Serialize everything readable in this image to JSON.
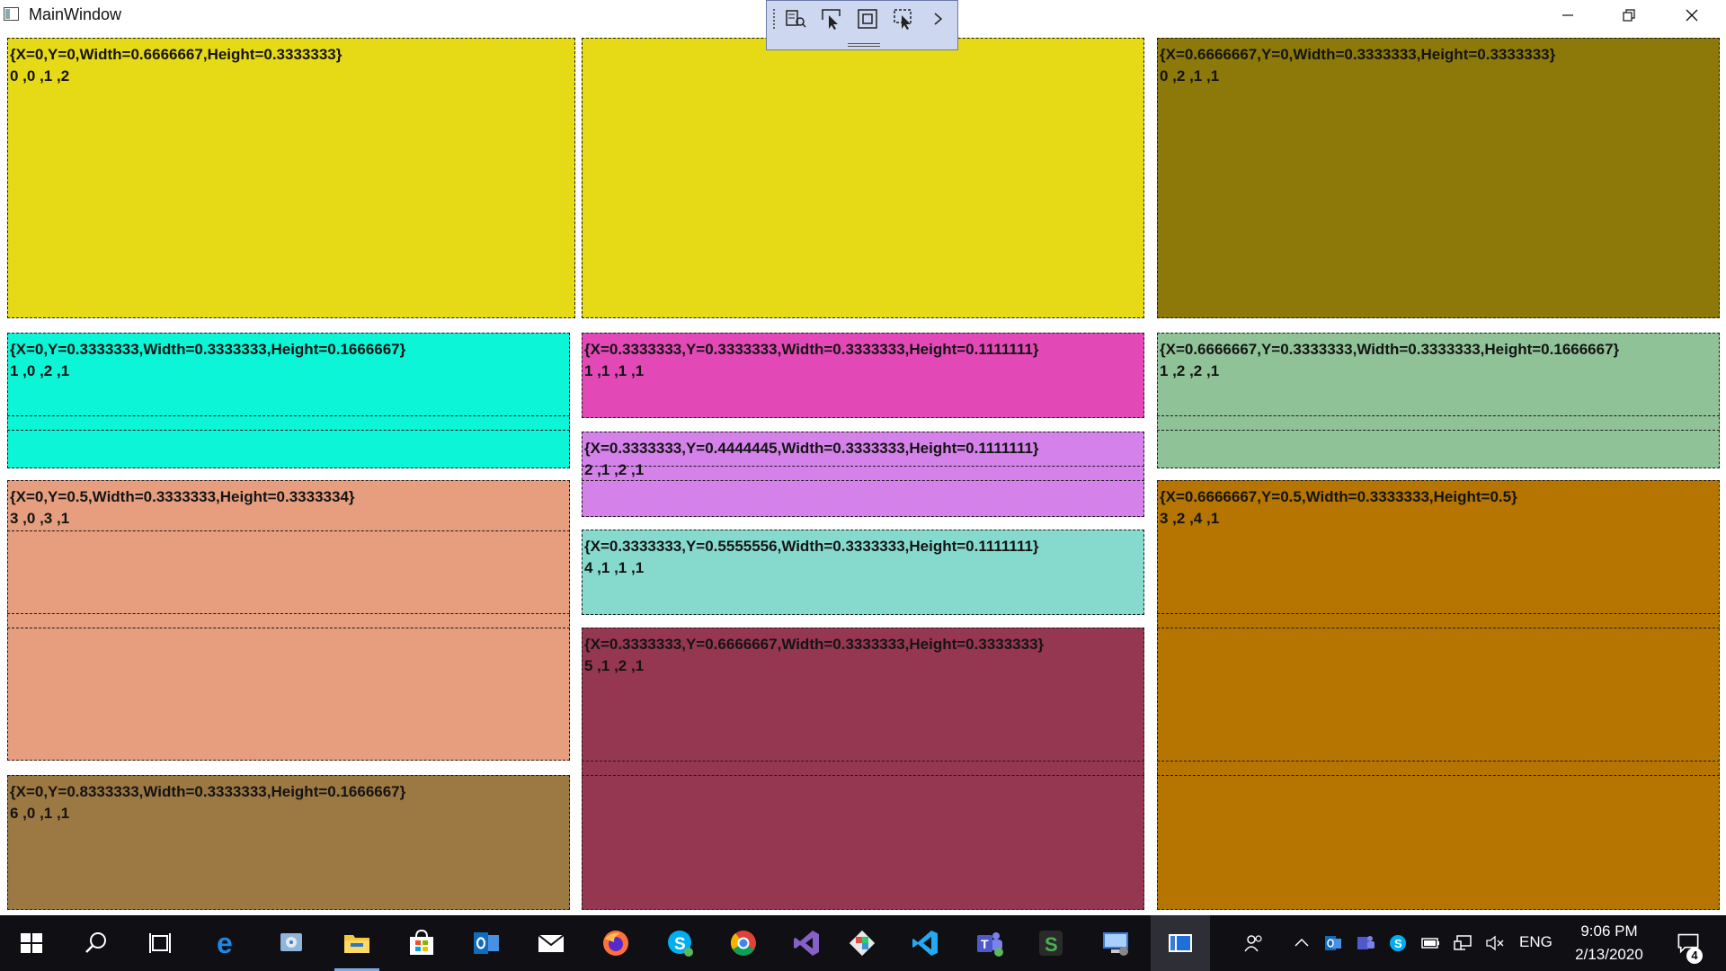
{
  "window": {
    "title": "MainWindow",
    "buttons": {
      "minimize": "minimize-icon",
      "restore": "restore-icon",
      "close": "close-icon"
    }
  },
  "debug_toolbar": {
    "buttons": [
      "live-visual-tree-icon",
      "select-element-icon",
      "display-layout-adorners-icon",
      "track-focused-element-icon"
    ],
    "expand": "chevron-right-icon"
  },
  "grid": {
    "cells": [
      {
        "rect": "{X=0,Y=0,Width=0.6666667,Height=0.3333333}",
        "pos": "0 ,0 ,1 ,2",
        "color": "#e6d916"
      },
      {
        "rect": "{X=0.6666667,Y=0,Width=0.3333333,Height=0.3333333}",
        "pos": "0 ,2 ,1 ,1",
        "color": "#8c790a"
      },
      {
        "rect": "{X=0,Y=0.3333333,Width=0.3333333,Height=0.1666667}",
        "pos": "1 ,0 ,2 ,1",
        "color": "#0cf5d6"
      },
      {
        "rect": "{X=0.3333333,Y=0.3333333,Width=0.3333333,Height=0.1111111}",
        "pos": "1 ,1 ,1 ,1",
        "color": "#e349b6"
      },
      {
        "rect": "{X=0.6666667,Y=0.3333333,Width=0.3333333,Height=0.1666667}",
        "pos": "1 ,2 ,2 ,1",
        "color": "#8fc297"
      },
      {
        "rect": "{X=0.3333333,Y=0.4444445,Width=0.3333333,Height=0.1111111}",
        "pos": "2 ,1 ,2 ,1",
        "color": "#d482e9"
      },
      {
        "rect": "{X=0,Y=0.5,Width=0.3333333,Height=0.3333334}",
        "pos": "3 ,0 ,3 ,1",
        "color": "#e69e7e"
      },
      {
        "rect": "{X=0.6666667,Y=0.5,Width=0.3333333,Height=0.5}",
        "pos": "3 ,2 ,4 ,1",
        "color": "#b57500"
      },
      {
        "rect": "{X=0.3333333,Y=0.5555556,Width=0.3333333,Height=0.1111111}",
        "pos": "4 ,1 ,1 ,1",
        "color": "#86dacd"
      },
      {
        "rect": "{X=0.3333333,Y=0.6666667,Width=0.3333333,Height=0.3333333}",
        "pos": "5 ,1 ,2 ,1",
        "color": "#963752"
      },
      {
        "rect": "{X=0,Y=0.8333333,Width=0.3333333,Height=0.1666667}",
        "pos": "6 ,0 ,1 ,1",
        "color": "#9c7843"
      }
    ]
  },
  "taskbar": {
    "apps": [
      "windows-start-icon",
      "search-icon",
      "task-view-icon",
      "edge-icon",
      "control-panel-icon",
      "file-explorer-icon",
      "store-icon",
      "outlook-icon",
      "mail-icon",
      "firefox-icon",
      "skype-icon",
      "chrome-icon",
      "visual-studio-icon",
      "git-extensions-icon",
      "vscode-icon",
      "teams-icon",
      "sublime-icon",
      "remote-desktop-icon",
      "main-window-app-icon"
    ],
    "tray": {
      "language": "ENG",
      "time": "9:06 PM",
      "date": "2/13/2020",
      "notifications": "4"
    }
  }
}
